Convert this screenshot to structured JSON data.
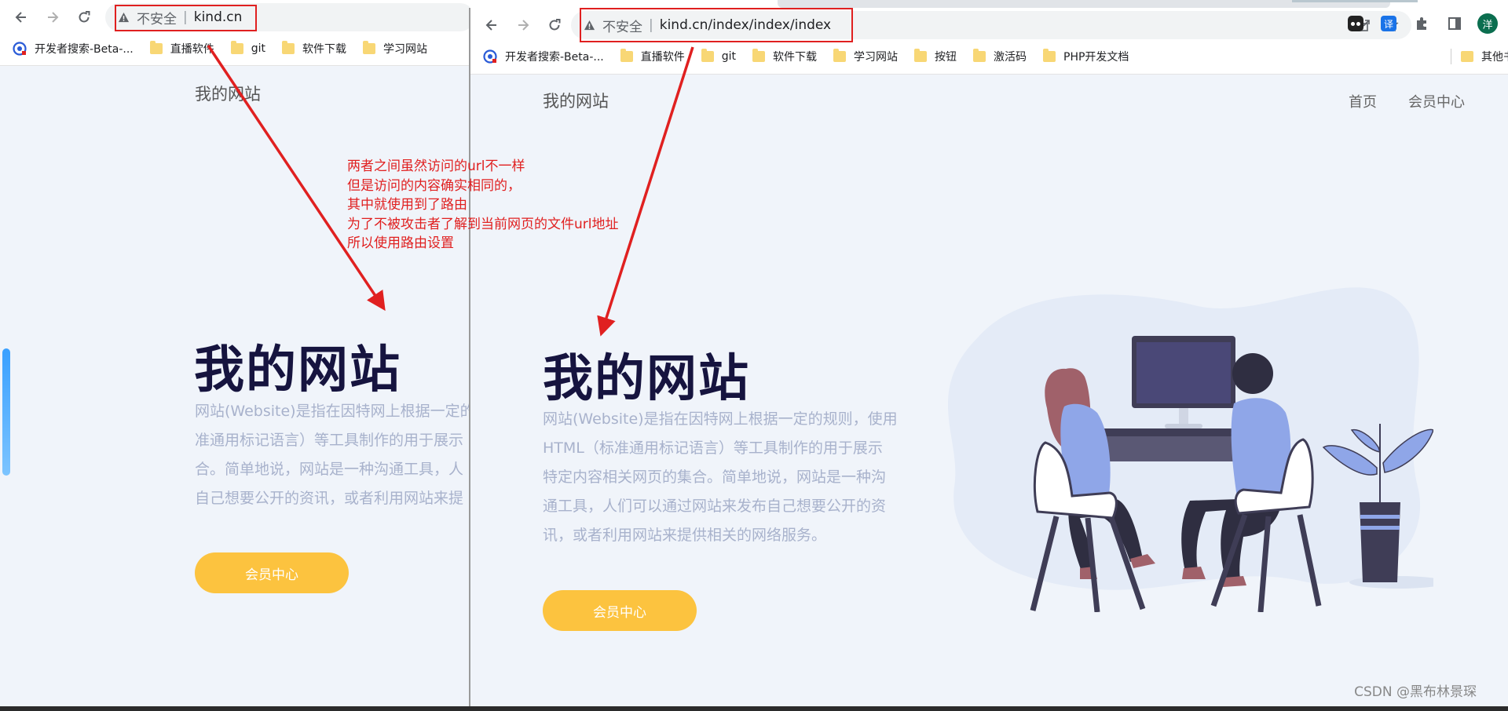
{
  "left_window": {
    "address": {
      "insecure": "不安全",
      "url": "kind.cn"
    },
    "bookmarks": [
      "开发者搜索-Beta-...",
      "直播软件",
      "git",
      "软件下载",
      "学习网站"
    ],
    "site": {
      "logo": "我的网站",
      "title": "我的网站",
      "desc_lines": [
        "网站(Website)是指在因特网上根据一定的",
        "准通用标记语言）等工具制作的用于展示",
        "合。简单地说，网站是一种沟通工具，人",
        "自己想要公开的资讯，或者利用网站来提"
      ],
      "button": "会员中心"
    }
  },
  "right_window": {
    "address": {
      "insecure": "不安全",
      "url": "kind.cn/index/index/index"
    },
    "bookmarks": [
      "开发者搜索-Beta-...",
      "直播软件",
      "git",
      "软件下载",
      "学习网站",
      "按钮",
      "激活码",
      "PHP开发文档"
    ],
    "bookmarks_other": "其他书",
    "avatar": "洋",
    "translate": "译",
    "site": {
      "logo": "我的网站",
      "nav": [
        "首页",
        "会员中心"
      ],
      "title": "我的网站",
      "desc_lines": [
        "网站(Website)是指在因特网上根据一定的规则，使用",
        "HTML（标准通用标记语言）等工具制作的用于展示",
        "特定内容相关网页的集合。简单地说，网站是一种沟",
        "通工具，人们可以通过网站来发布自己想要公开的资",
        "讯，或者利用网站来提供相关的网络服务。"
      ],
      "button": "会员中心"
    }
  },
  "annotation_lines": [
    "两者之间虽然访问的url不一样",
    "但是访问的内容确实相同的，",
    "其中就使用到了路由",
    "为了不被攻击者了解到当前网页的文件url地址",
    "所以使用路由设置"
  ],
  "watermark": "CSDN @黑布林景琛",
  "colors": {
    "annotation": "#e02020",
    "button": "#fcc33f",
    "title": "#16143f",
    "desc": "#a8b2cc",
    "bg": "#f0f4fa"
  }
}
